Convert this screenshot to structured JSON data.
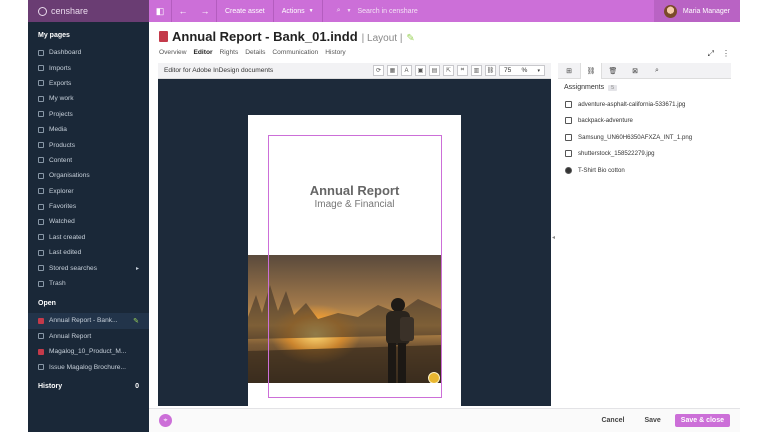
{
  "brand": {
    "logo_text": "censhare",
    "accent": "#cc6fd8"
  },
  "topbar": {
    "create_asset": "Create asset",
    "actions": "Actions",
    "search_placeholder": "Search in censhare",
    "user_name": "Maria Manager"
  },
  "sidebar": {
    "my_pages_heading": "My pages",
    "items": [
      {
        "label": "Dashboard",
        "icon": "dashboard-icon"
      },
      {
        "label": "Imports",
        "icon": "import-icon"
      },
      {
        "label": "Exports",
        "icon": "export-icon"
      },
      {
        "label": "My work",
        "icon": "work-icon"
      },
      {
        "label": "Projects",
        "icon": "projects-icon"
      },
      {
        "label": "Media",
        "icon": "media-icon"
      },
      {
        "label": "Products",
        "icon": "products-icon"
      },
      {
        "label": "Content",
        "icon": "content-icon"
      },
      {
        "label": "Organisations",
        "icon": "organisations-icon"
      },
      {
        "label": "Explorer",
        "icon": "explorer-icon"
      },
      {
        "label": "Favorites",
        "icon": "favorites-icon"
      },
      {
        "label": "Watched",
        "icon": "watched-icon"
      },
      {
        "label": "Last created",
        "icon": "clock-icon"
      },
      {
        "label": "Last edited",
        "icon": "clock-icon"
      },
      {
        "label": "Stored searches",
        "icon": "search-icon"
      },
      {
        "label": "Trash",
        "icon": "trash-icon"
      }
    ],
    "open_heading": "Open",
    "open_items": [
      {
        "label": "Annual Report - Bank..."
      },
      {
        "label": "Annual Report"
      },
      {
        "label": "Magalog_10_Product_M..."
      },
      {
        "label": "Issue Magalog Brochure..."
      }
    ],
    "history_heading": "History",
    "history_count": "0"
  },
  "document": {
    "title": "Annual Report - Bank_01.indd",
    "type_label": "| Layout |",
    "tabs": [
      "Overview",
      "Editor",
      "Rights",
      "Details",
      "Communication",
      "History"
    ],
    "active_tab": "Editor"
  },
  "editor": {
    "toolbar_label": "Editor for Adobe InDesign documents",
    "zoom_value": "75",
    "zoom_unit": "%",
    "page_title": "Annual Report",
    "page_subtitle": "Image & Financial"
  },
  "assignments": {
    "heading": "Assignments",
    "count": "5",
    "items": [
      "adventure-asphalt-california-533671.jpg",
      "backpack-adventure",
      "Samsung_UN60H6350AFXZA_INT_1.png",
      "shutterstock_158522279.jpg",
      "T-Shirt Bio cotton"
    ]
  },
  "footer": {
    "cancel": "Cancel",
    "save": "Save",
    "save_close": "Save & close"
  }
}
